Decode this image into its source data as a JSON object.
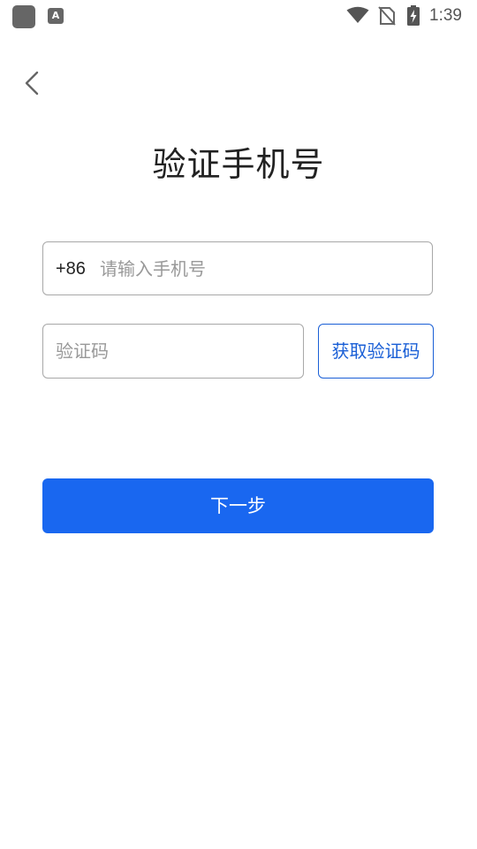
{
  "status_bar": {
    "time": "1:39",
    "app_icon": "app-icon",
    "notification_icon_letter": "A",
    "wifi_icon": "wifi-icon",
    "sim_icon": "no-sim-icon",
    "battery_icon": "battery-charging-icon"
  },
  "header": {
    "back_icon": "chevron-left-icon",
    "title": "验证手机号"
  },
  "form": {
    "country_code": "+86",
    "phone_placeholder": "请输入手机号",
    "phone_value": "",
    "code_placeholder": "验证码",
    "code_value": "",
    "get_code_label": "获取验证码",
    "next_label": "下一步"
  },
  "colors": {
    "accent": "#1967f0",
    "link": "#1a5fd6",
    "border": "#a8a8a8",
    "placeholder": "#999999"
  }
}
